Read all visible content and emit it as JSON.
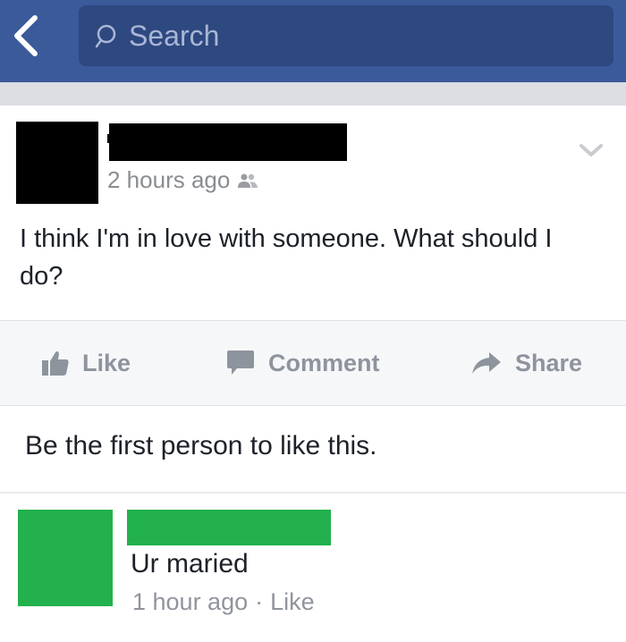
{
  "search": {
    "placeholder": "Search"
  },
  "post": {
    "timestamp": "2 hours ago",
    "text": "I think I'm in love with someone. What should I do?"
  },
  "actions": {
    "like": "Like",
    "comment": "Comment",
    "share": "Share"
  },
  "likes_summary": "Be the first person to like this.",
  "comment": {
    "text": "Ur maried",
    "timestamp": "1 hour ago",
    "separator": "·",
    "like": "Like"
  },
  "colors": {
    "header": "#3b5a9a",
    "search_field": "#2e4880",
    "redaction_black": "#000000",
    "redaction_green": "#22b14c"
  },
  "icons": [
    "back-chevron-icon",
    "search-icon",
    "audience-friends-icon",
    "post-options-chevron-icon",
    "thumbs-up-icon",
    "comment-bubble-icon",
    "share-arrow-icon"
  ]
}
